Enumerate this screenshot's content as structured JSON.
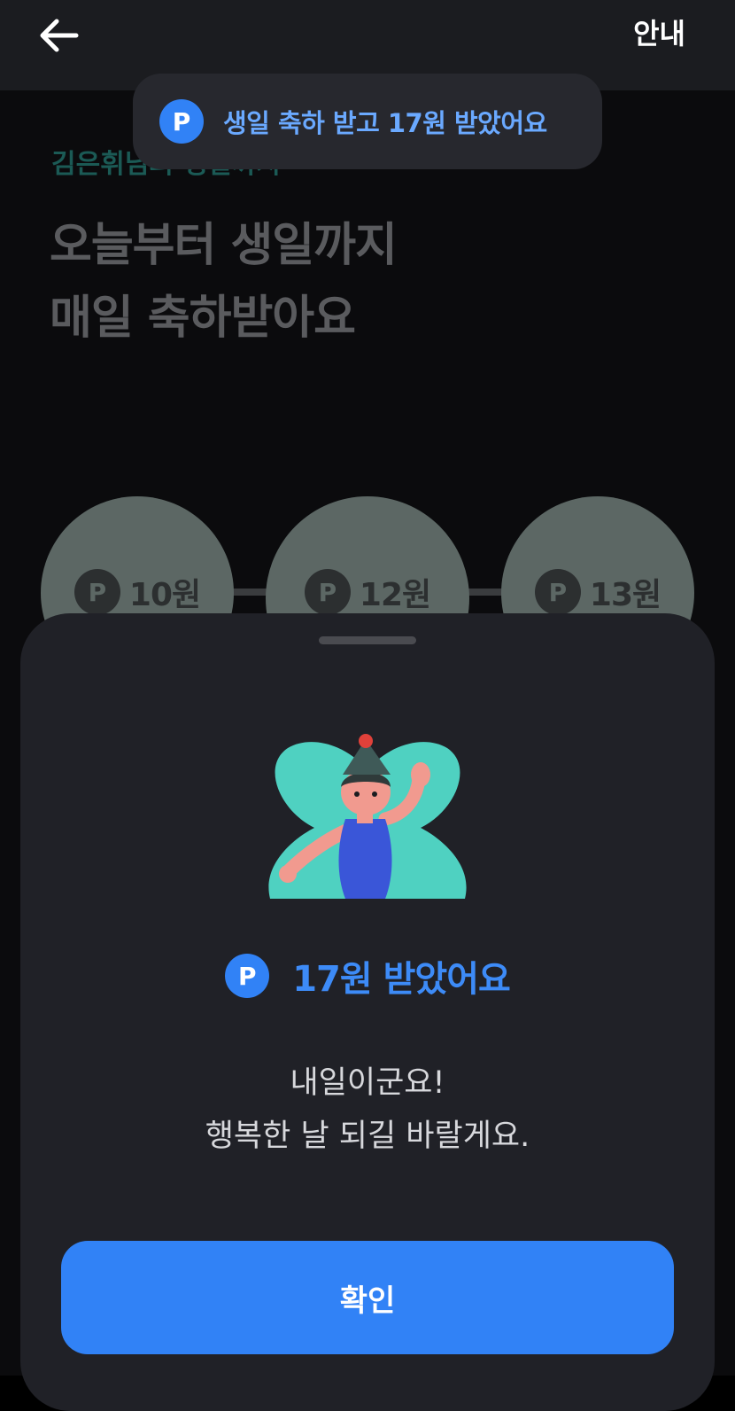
{
  "header": {
    "back_icon": "arrow-left-icon",
    "info_label": "안내"
  },
  "toast": {
    "badge": "P",
    "text": "생일 축하 받고 17원 받았어요"
  },
  "background": {
    "subtitle": "김은휘님의 생일까지",
    "headline_line1": "오늘부터 생일까지",
    "headline_line2": "매일 축하받아요",
    "rewards": [
      {
        "badge": "P",
        "amount": "10원"
      },
      {
        "badge": "P",
        "amount": "12원"
      },
      {
        "badge": "P",
        "amount": "13원"
      }
    ]
  },
  "sheet": {
    "illustration": "waving-character-illustration",
    "reward_badge": "P",
    "reward_text": "17원 받았어요",
    "message_line1": "내일이군요!",
    "message_line2": "행복한 날 되길 바랄게요.",
    "confirm_label": "확인"
  },
  "colors": {
    "accent": "#3182f6",
    "accent_text": "#3d8bf7",
    "sheet_bg": "#202127",
    "illustration_bg": "#4fd1c1"
  }
}
